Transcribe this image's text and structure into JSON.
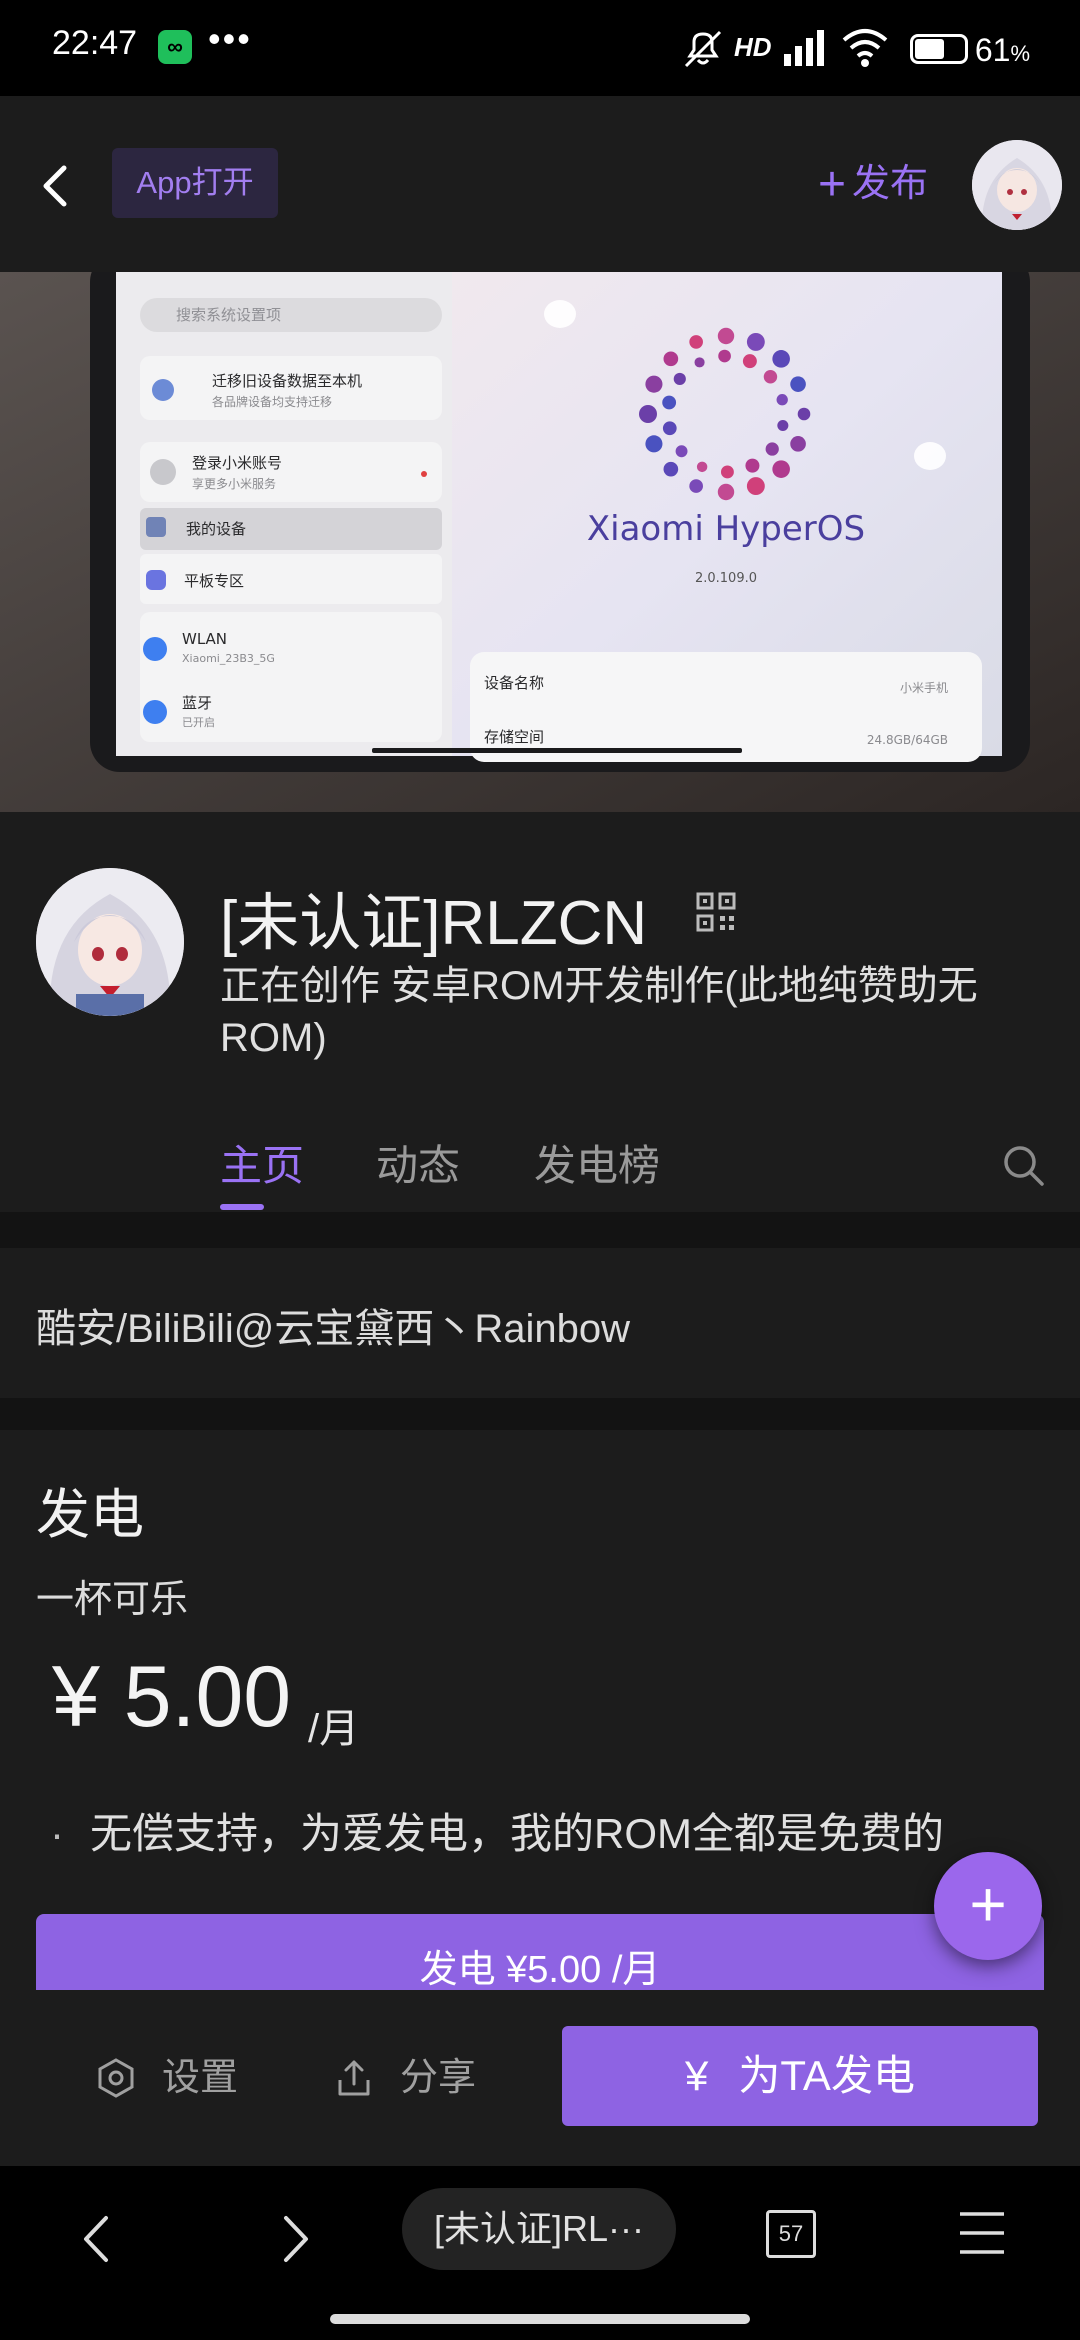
{
  "status_bar": {
    "time": "22:47",
    "battery_percent": "61",
    "battery_unit": "%",
    "icons": [
      "app-notification-icon",
      "more-dots-icon",
      "mute-icon",
      "hd-icon",
      "signal-icon",
      "wifi-icon",
      "battery-icon"
    ]
  },
  "top_nav": {
    "app_open": "App打开",
    "publish": "发布"
  },
  "banner": {
    "settings_search": "搜索系统设置项",
    "migrate_title": "迁移旧设备数据至本机",
    "migrate_sub": "各品牌设备均支持迁移",
    "login_title": "登录小米账号",
    "login_sub": "享更多小米服务",
    "my_device": "我的设备",
    "tablet_zone": "平板专区",
    "wlan": "WLAN",
    "wlan_sub": "Xiaomi_23B3_5G",
    "bluetooth": "蓝牙",
    "bluetooth_sub": "已开启",
    "os_name": "Xiaomi HyperOS",
    "os_version": "2.0.109.0",
    "device_name_label": "设备名称",
    "device_name_value": "小米手机",
    "storage_label": "存储空间",
    "storage_value": "24.8GB/64GB"
  },
  "profile": {
    "name": "[未认证]RLZCN",
    "desc": "正在创作 安卓ROM开发制作(此地纯赞助无ROM)",
    "tabs": [
      "主页",
      "动态",
      "发电榜"
    ]
  },
  "links_text": "酷安/BiliBili@云宝黛西丶Rainbow",
  "charge": {
    "title": "发电",
    "tier": "一杯可乐",
    "price": "¥ 5.00",
    "unit": "/月",
    "perk": "无偿支持，为爱发电，我的ROM全都是免费的",
    "perk_bullet": "·",
    "button": "发电 ¥5.00 /月"
  },
  "fab": "+",
  "action_bar": {
    "settings": "设置",
    "share": "分享",
    "charge_yen": "¥",
    "charge_btn": "为TA发电"
  },
  "browser_bar": {
    "title": "[未认证]RL···",
    "tab_count": "57"
  },
  "colors": {
    "accent": "#9A72F4",
    "button": "#8E63E3",
    "card_bg": "#1C1C1C",
    "page_bg": "#131313"
  }
}
